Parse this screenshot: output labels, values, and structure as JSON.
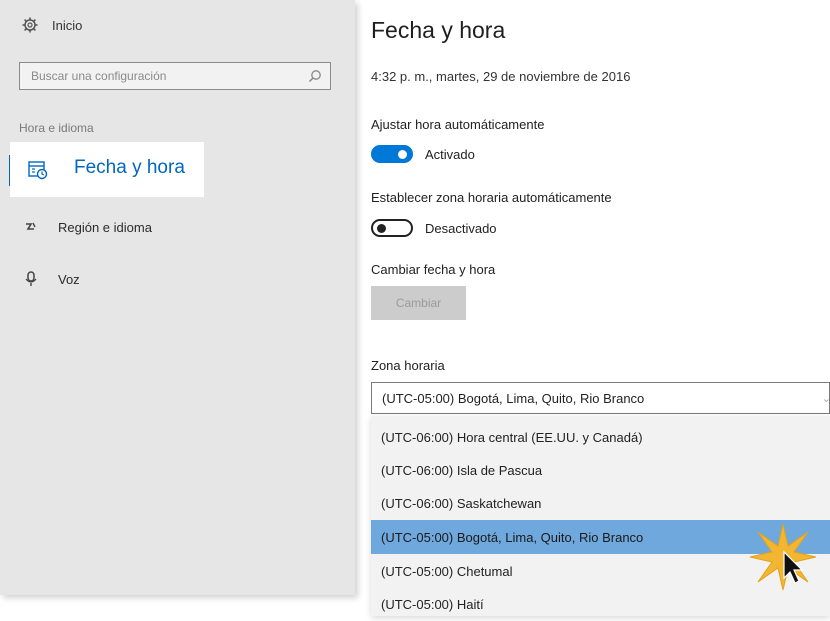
{
  "sidebar": {
    "home_label": "Inicio",
    "search_placeholder": "Buscar una configuración",
    "section_label": "Hora e idioma",
    "items": [
      {
        "label": "Fecha y hora",
        "icon": "calendar-clock-icon",
        "active": true
      },
      {
        "label": "Región e idioma",
        "icon": "region-icon",
        "active": false
      },
      {
        "label": "Voz",
        "icon": "microphone-icon",
        "active": false
      }
    ]
  },
  "main": {
    "title": "Fecha y hora",
    "current_datetime": "4:32 p. m., martes, 29 de noviembre de 2016",
    "auto_time": {
      "label": "Ajustar hora automáticamente",
      "state": "Activado",
      "on": true
    },
    "auto_timezone": {
      "label": "Establecer zona horaria automáticamente",
      "state": "Desactivado",
      "on": false
    },
    "change_section": {
      "label": "Cambiar fecha y hora",
      "button": "Cambiar"
    },
    "timezone": {
      "label": "Zona horaria",
      "selected": "(UTC-05:00) Bogotá, Lima, Quito, Rio Branco",
      "options": [
        "(UTC-06:00) Hora central (EE.UU. y Canadá)",
        "(UTC-06:00) Isla de Pascua",
        "(UTC-06:00) Saskatchewan",
        "(UTC-05:00) Bogotá, Lima, Quito, Rio Branco",
        "(UTC-05:00) Chetumal",
        "(UTC-05:00) Haití"
      ],
      "highlighted_index": 3
    }
  },
  "colors": {
    "accent": "#0078d7",
    "highlight": "#6fa8dc",
    "sidebar_bg": "#e6e6e6"
  }
}
